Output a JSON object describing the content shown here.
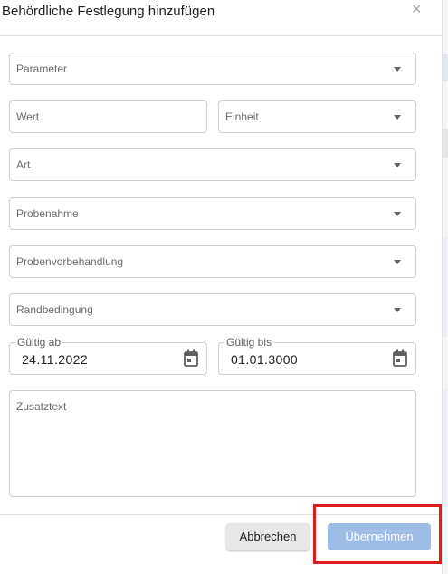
{
  "dialog": {
    "title": "Behördliche Festlegung hinzufügen",
    "close_glyph": "×"
  },
  "fields": {
    "parameter": {
      "placeholder": "Parameter",
      "icon": "chevron-down-icon"
    },
    "wert": {
      "placeholder": "Wert"
    },
    "einheit": {
      "placeholder": "Einheit",
      "icon": "chevron-down-icon"
    },
    "art": {
      "placeholder": "Art",
      "icon": "chevron-down-icon"
    },
    "probenahme": {
      "placeholder": "Probenahme",
      "icon": "chevron-down-icon"
    },
    "probenvorbehandlung": {
      "placeholder": "Probenvorbehandlung",
      "icon": "chevron-down-icon"
    },
    "randbedingung": {
      "placeholder": "Randbedingung",
      "icon": "chevron-down-icon"
    },
    "gueltig_ab": {
      "label": "Gültig ab",
      "value": "24.11.2022",
      "icon": "calendar-icon"
    },
    "gueltig_bis": {
      "label": "Gültig bis",
      "value": "01.01.3000",
      "icon": "calendar-icon"
    },
    "zusatztext": {
      "placeholder": "Zusatztext"
    }
  },
  "actions": {
    "cancel_label": "Abbrechen",
    "apply_label": "Übernehmen",
    "highlight_color": "#e01b1b"
  },
  "colors": {
    "apply_button": "#9dbde6",
    "cancel_button": "#e8e8e8",
    "border": "#cfcfcf"
  }
}
